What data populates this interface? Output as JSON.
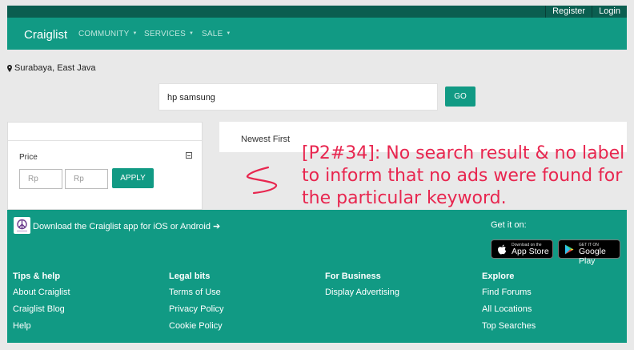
{
  "topbar": {
    "register": "Register",
    "login": "Login"
  },
  "navbar": {
    "brand": "Craiglist",
    "items": [
      "COMMUNITY",
      "SERVICES",
      "SALE"
    ]
  },
  "location": "Surabaya, East Java",
  "search": {
    "value": "hp samsung",
    "button": "GO"
  },
  "filter": {
    "price_label": "Price",
    "min_placeholder": "Rp",
    "max_placeholder": "Rp",
    "apply": "APPLY"
  },
  "sort": {
    "label": "Newest First"
  },
  "annotation": {
    "text": "[P2#34]: No search result & no label to inform that no ads were found for the particular keyword.",
    "color": "#e8264f"
  },
  "footer": {
    "app_text": "Download the Craiglist app for iOS or Android ➔",
    "get_it_on": "Get it on:",
    "app_store": {
      "small": "Download on the",
      "big": "App Store"
    },
    "google_play": {
      "small": "GET IT ON",
      "big": "Google Play"
    },
    "columns": [
      {
        "heading": "Tips & help",
        "links": [
          "About Craiglist",
          "Craiglist Blog",
          "Help"
        ]
      },
      {
        "heading": "Legal bits",
        "links": [
          "Terms of Use",
          "Privacy Policy",
          "Cookie Policy"
        ]
      },
      {
        "heading": "For Business",
        "links": [
          "Display Advertising"
        ]
      },
      {
        "heading": "Explore",
        "links": [
          "Find Forums",
          "All Locations",
          "Top Searches"
        ]
      }
    ]
  },
  "colors": {
    "primary": "#119a84",
    "topbar": "#0b5e50",
    "background": "#e9e9e9"
  }
}
